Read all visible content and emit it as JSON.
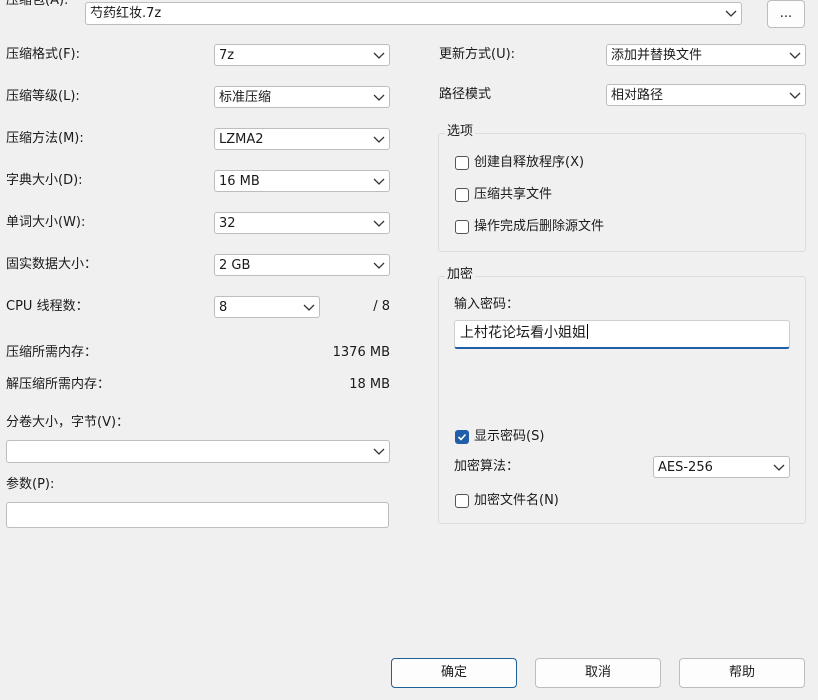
{
  "archive": {
    "label": "压缩包(A):",
    "value": "芍药红妆.7z",
    "browse": "..."
  },
  "left": {
    "format": {
      "label": "压缩格式(F):",
      "value": "7z"
    },
    "level": {
      "label": "压缩等级(L):",
      "value": "标准压缩"
    },
    "method": {
      "label": "压缩方法(M):",
      "value": "LZMA2"
    },
    "dict": {
      "label": "字典大小(D):",
      "value": "16 MB"
    },
    "word": {
      "label": "单词大小(W):",
      "value": "32"
    },
    "solid": {
      "label": "固实数据大小：",
      "value": "2 GB"
    },
    "cpu": {
      "label": "CPU 线程数：",
      "value": "8",
      "total": "/ 8"
    },
    "mem_comp": {
      "label": "压缩所需内存：",
      "value": "1376 MB"
    },
    "mem_decomp": {
      "label": "解压缩所需内存：",
      "value": "18 MB"
    },
    "volume": {
      "label": "分卷大小，字节(V)：",
      "value": ""
    },
    "params": {
      "label": "参数(P):",
      "value": ""
    }
  },
  "right": {
    "update": {
      "label": "更新方式(U):",
      "value": "添加并替换文件"
    },
    "path": {
      "label": "路径模式",
      "value": "相对路径"
    },
    "options": {
      "title": "选项",
      "sfx": {
        "label": "创建自释放程序(X)",
        "checked": false
      },
      "shared": {
        "label": "压缩共享文件",
        "checked": false
      },
      "delete": {
        "label": "操作完成后删除源文件",
        "checked": false
      }
    },
    "encryption": {
      "title": "加密",
      "password_label": "输入密码：",
      "password_value": "上村花论坛看小姐姐",
      "show_password": {
        "label": "显示密码(S)",
        "checked": true
      },
      "method_label": "加密算法：",
      "method_value": "AES-256",
      "encrypt_names": {
        "label": "加密文件名(N)",
        "checked": false
      }
    }
  },
  "buttons": {
    "ok": "确定",
    "cancel": "取消",
    "help": "帮助"
  },
  "colors": {
    "accent": "#1f5fa8",
    "background": "#f0f0f0"
  },
  "icons": {
    "dropdown": "chevron-down-icon",
    "checkbox_checked": "check-icon"
  }
}
